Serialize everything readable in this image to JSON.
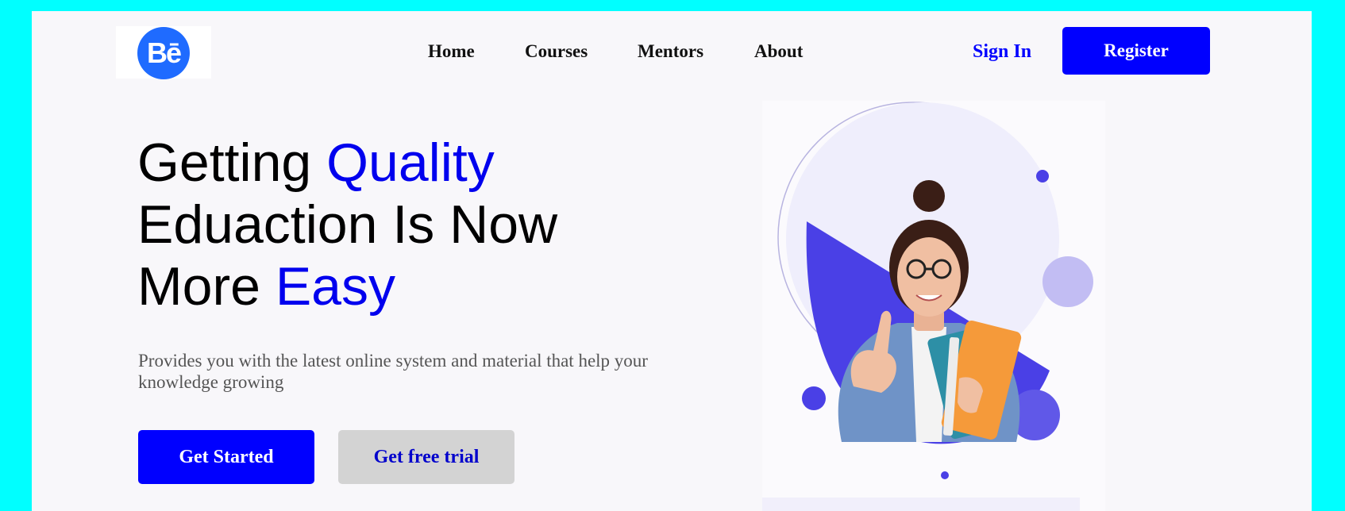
{
  "header": {
    "logo_text": "Bē",
    "nav": [
      {
        "label": "Home"
      },
      {
        "label": "Courses"
      },
      {
        "label": "Mentors"
      },
      {
        "label": "About"
      }
    ],
    "sign_in_label": "Sign In",
    "register_label": "Register"
  },
  "hero": {
    "headline": {
      "line1_a": "Getting ",
      "line1_b": "Quality",
      "line2": "Eduaction Is Now",
      "line3_a": "More ",
      "line3_b": "Easy"
    },
    "subtext": "Provides you with the latest online system and material that help your knowledge growing",
    "primary_button": "Get Started",
    "secondary_button": "Get free trial"
  },
  "illustration": {
    "icon": "student-with-books-illustration"
  },
  "colors": {
    "accent": "#0000ff",
    "page_border": "#00ffff",
    "page_background": "#f8f7fa",
    "logo": "#1f6bff",
    "illustration_purple": "#4a40e6"
  }
}
